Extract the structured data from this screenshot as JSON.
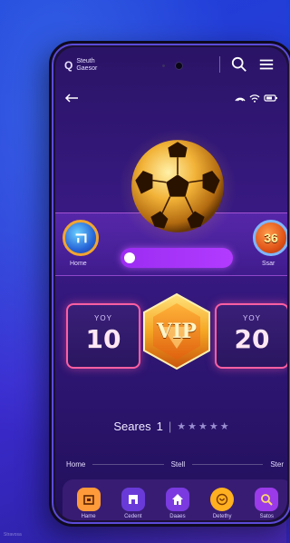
{
  "brand": {
    "line1": "Steuth",
    "line2": "Gaesor",
    "logo_icon": "q-logo-icon"
  },
  "toolbar": {
    "search_icon": "search-icon",
    "menu_icon": "menu-icon"
  },
  "header": {
    "back_icon": "back-arrow-icon",
    "status_icons": [
      "signal-icon",
      "wifi-icon",
      "battery-icon"
    ]
  },
  "players": {
    "left": {
      "label": "Home",
      "icon": "profile-icon"
    },
    "right": {
      "value": "36",
      "label": "Ssar"
    }
  },
  "progress": {
    "value_fraction": 0.05
  },
  "cards": {
    "left": {
      "tag": "YOY",
      "value": "10"
    },
    "right": {
      "tag": "YOY",
      "value": "20"
    }
  },
  "vip": {
    "label": "VIP"
  },
  "rating": {
    "label": "Seares",
    "value": "1",
    "stars": 5
  },
  "section_tabs": {
    "left": "Home",
    "center": "Stell",
    "right": "Ster"
  },
  "bottom_nav": [
    {
      "label": "Hame",
      "icon": "home-icon",
      "color": "#ff9a3a"
    },
    {
      "label": "Cedent",
      "icon": "gate-icon",
      "color": "#6a3ad8"
    },
    {
      "label": "Daaes",
      "icon": "house-icon",
      "color": "#7a3ae0"
    },
    {
      "label": "Detethy",
      "icon": "coin-icon",
      "color": "#ffb020"
    },
    {
      "label": "Satos",
      "icon": "magnify-icon",
      "color": "#9a3ae8"
    }
  ],
  "watermark": "Stravosa"
}
